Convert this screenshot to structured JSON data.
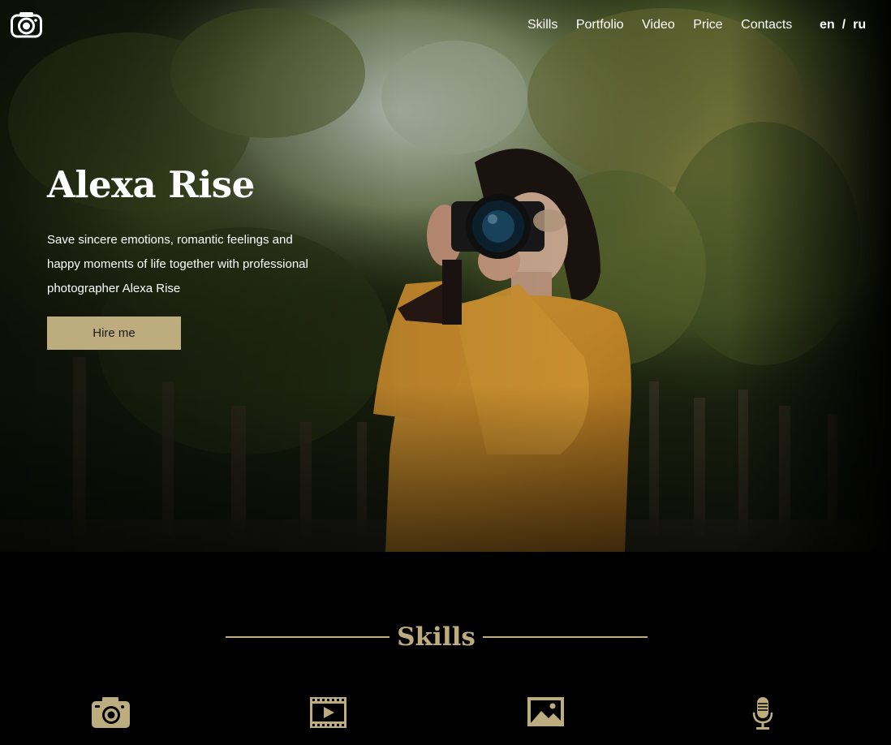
{
  "header": {
    "logo_icon": "camera-logo-icon",
    "nav": [
      "Skills",
      "Portfolio",
      "Video",
      "Price",
      "Contacts"
    ],
    "lang": {
      "en": "en",
      "separator": "/",
      "ru": "ru"
    }
  },
  "hero": {
    "title": "Alexa Rise",
    "text_lines": [
      "Save sincere emotions, romantic feelings and",
      "happy moments of life together with professional",
      "photographer Alexa Rise"
    ],
    "cta": "Hire me"
  },
  "skills": {
    "title": "Skills",
    "icons": [
      "camera-icon",
      "video-icon",
      "image-icon",
      "microphone-icon"
    ]
  },
  "colors": {
    "accent": "#bdac7e",
    "background": "#000000",
    "text": "#ffffff"
  }
}
